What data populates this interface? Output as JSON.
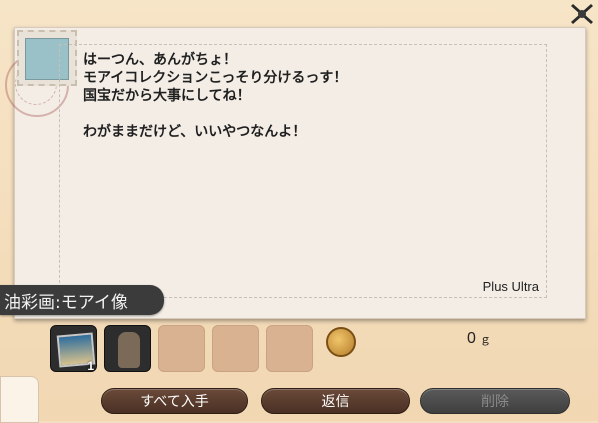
{
  "letter": {
    "message": "はーつん、あんがちょ！\nモアイコレクションこっそり分けるっす！\n国宝だから大事にしてね！\n\nわがままだけど、いいやつなんよ！",
    "signature": "Plus Ultra"
  },
  "attachment": {
    "item_name": "油彩画:モアイ像",
    "slots": [
      {
        "state": "filled",
        "icon": "painting-icon",
        "qty": "1"
      },
      {
        "state": "filled",
        "icon": "moai-icon",
        "qty": ""
      },
      {
        "state": "empty",
        "icon": "",
        "qty": ""
      },
      {
        "state": "empty",
        "icon": "",
        "qty": ""
      },
      {
        "state": "empty",
        "icon": "",
        "qty": ""
      }
    ],
    "gil": "0",
    "gil_unit": "ｇ"
  },
  "buttons": {
    "take_all": "すべて入手",
    "reply": "返信",
    "delete": "削除"
  },
  "colors": {
    "frame": "#f5dfbf",
    "paper": "#f3ede6",
    "button": "#4a3024"
  }
}
